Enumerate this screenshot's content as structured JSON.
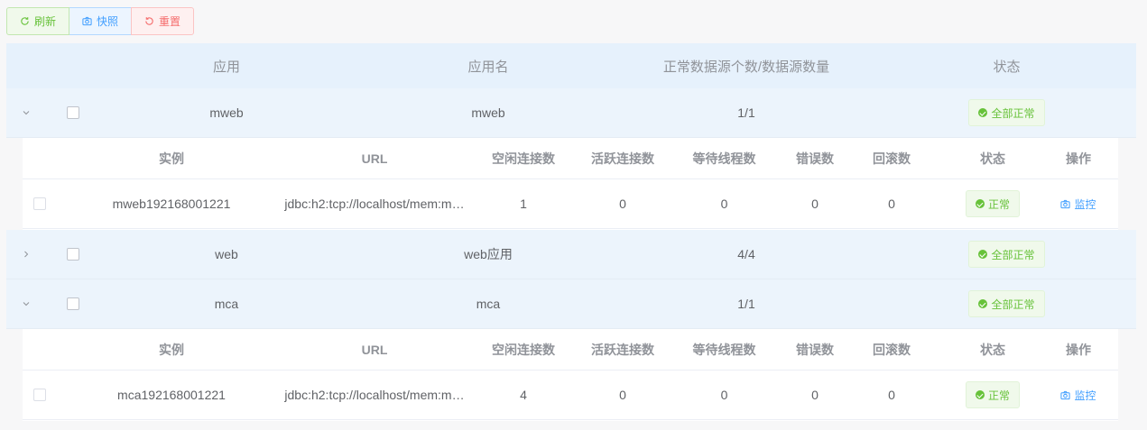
{
  "toolbar": {
    "refresh_label": "刷新",
    "snapshot_label": "快照",
    "reset_label": "重置"
  },
  "table": {
    "headers": {
      "app": "应用",
      "app_name": "应用名",
      "ds_count": "正常数据源个数/数据源数量",
      "status": "状态"
    },
    "rows": [
      {
        "app": "mweb",
        "app_name": "mweb",
        "ds_count": "1/1",
        "status": "全部正常",
        "expanded": true,
        "instances": [
          {
            "instance": "mweb192168001221",
            "url": "jdbc:h2:tcp://localhost/mem:m…",
            "idle": "1",
            "active": "0",
            "waiting": "0",
            "errors": "0",
            "rollbacks": "0",
            "status": "正常",
            "action": "监控"
          }
        ]
      },
      {
        "app": "web",
        "app_name": "web应用",
        "ds_count": "4/4",
        "status": "全部正常",
        "expanded": false
      },
      {
        "app": "mca",
        "app_name": "mca",
        "ds_count": "1/1",
        "status": "全部正常",
        "expanded": true,
        "instances": [
          {
            "instance": "mca192168001221",
            "url": "jdbc:h2:tcp://localhost/mem:m…",
            "idle": "4",
            "active": "0",
            "waiting": "0",
            "errors": "0",
            "rollbacks": "0",
            "status": "正常",
            "action": "监控"
          }
        ]
      }
    ]
  },
  "subtable": {
    "headers": {
      "instance": "实例",
      "url": "URL",
      "idle": "空闲连接数",
      "active": "活跃连接数",
      "waiting": "等待线程数",
      "errors": "错误数",
      "rollbacks": "回滚数",
      "status": "状态",
      "action": "操作"
    }
  },
  "icons": {
    "expanded": "chevron-down-icon",
    "collapsed": "chevron-right-icon",
    "status_ok": "check-circle-icon",
    "monitor": "camera-icon"
  },
  "colors": {
    "success": "#67c23a",
    "primary": "#409eff",
    "danger": "#f56c6c",
    "header_bg": "#e6f1fc"
  }
}
